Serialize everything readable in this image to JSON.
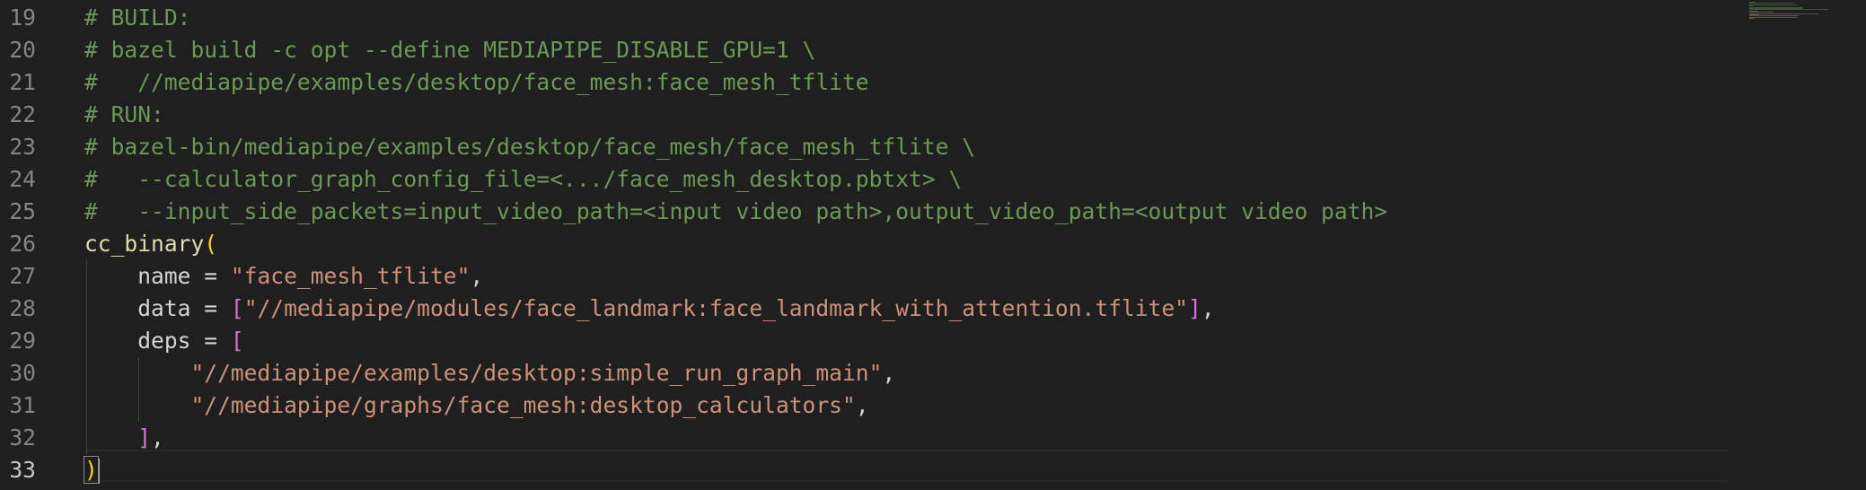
{
  "editor": {
    "active_line": 33,
    "lines": [
      {
        "number": "19",
        "tokens": [
          {
            "t": "# BUILD:",
            "c": "cm"
          }
        ]
      },
      {
        "number": "20",
        "tokens": [
          {
            "t": "# bazel build -c opt --define MEDIAPIPE_DISABLE_GPU=1 \\",
            "c": "cm"
          }
        ]
      },
      {
        "number": "21",
        "tokens": [
          {
            "t": "#   //mediapipe/examples/desktop/face_mesh:face_mesh_tflite",
            "c": "cm"
          }
        ]
      },
      {
        "number": "22",
        "tokens": [
          {
            "t": "# RUN:",
            "c": "cm"
          }
        ]
      },
      {
        "number": "23",
        "tokens": [
          {
            "t": "# bazel-bin/mediapipe/examples/desktop/face_mesh/face_mesh_tflite \\",
            "c": "cm"
          }
        ]
      },
      {
        "number": "24",
        "tokens": [
          {
            "t": "#   --calculator_graph_config_file=<.../face_mesh_desktop.pbtxt> \\",
            "c": "cm"
          }
        ]
      },
      {
        "number": "25",
        "tokens": [
          {
            "t": "#   --input_side_packets=input_video_path=<input video path>,output_video_path=<output video path>",
            "c": "cm"
          }
        ]
      },
      {
        "number": "26",
        "tokens": [
          {
            "t": "cc_binary",
            "c": "fn"
          },
          {
            "t": "(",
            "c": "b1"
          }
        ]
      },
      {
        "number": "27",
        "tokens": [
          {
            "t": "    name = ",
            "c": "pl"
          },
          {
            "t": "\"face_mesh_tflite\"",
            "c": "st"
          },
          {
            "t": ",",
            "c": "pl"
          }
        ]
      },
      {
        "number": "28",
        "tokens": [
          {
            "t": "    data = ",
            "c": "pl"
          },
          {
            "t": "[",
            "c": "b2"
          },
          {
            "t": "\"//mediapipe/modules/face_landmark:face_landmark_with_attention.tflite\"",
            "c": "st"
          },
          {
            "t": "]",
            "c": "b2"
          },
          {
            "t": ",",
            "c": "pl"
          }
        ]
      },
      {
        "number": "29",
        "tokens": [
          {
            "t": "    deps = ",
            "c": "pl"
          },
          {
            "t": "[",
            "c": "b2"
          }
        ]
      },
      {
        "number": "30",
        "tokens": [
          {
            "t": "        \"//mediapipe/examples/desktop:simple_run_graph_main\"",
            "c": "st"
          },
          {
            "t": ",",
            "c": "pl"
          }
        ]
      },
      {
        "number": "31",
        "tokens": [
          {
            "t": "        \"//mediapipe/graphs/face_mesh:desktop_calculators\"",
            "c": "st"
          },
          {
            "t": ",",
            "c": "pl"
          }
        ]
      },
      {
        "number": "32",
        "tokens": [
          {
            "t": "    ",
            "c": "pl"
          },
          {
            "t": "]",
            "c": "b2"
          },
          {
            "t": ",",
            "c": "pl"
          }
        ]
      },
      {
        "number": "33",
        "tokens": [
          {
            "t": ")",
            "c": "b1 cursor-bracket"
          }
        ]
      }
    ]
  },
  "colors": {
    "background": "#1f1f1f",
    "comment": "#6a9955",
    "function": "#dcdcaa",
    "string": "#ce9178",
    "bracket_level1": "#ffd700",
    "bracket_level2": "#da70d6",
    "line_number": "#858585"
  }
}
